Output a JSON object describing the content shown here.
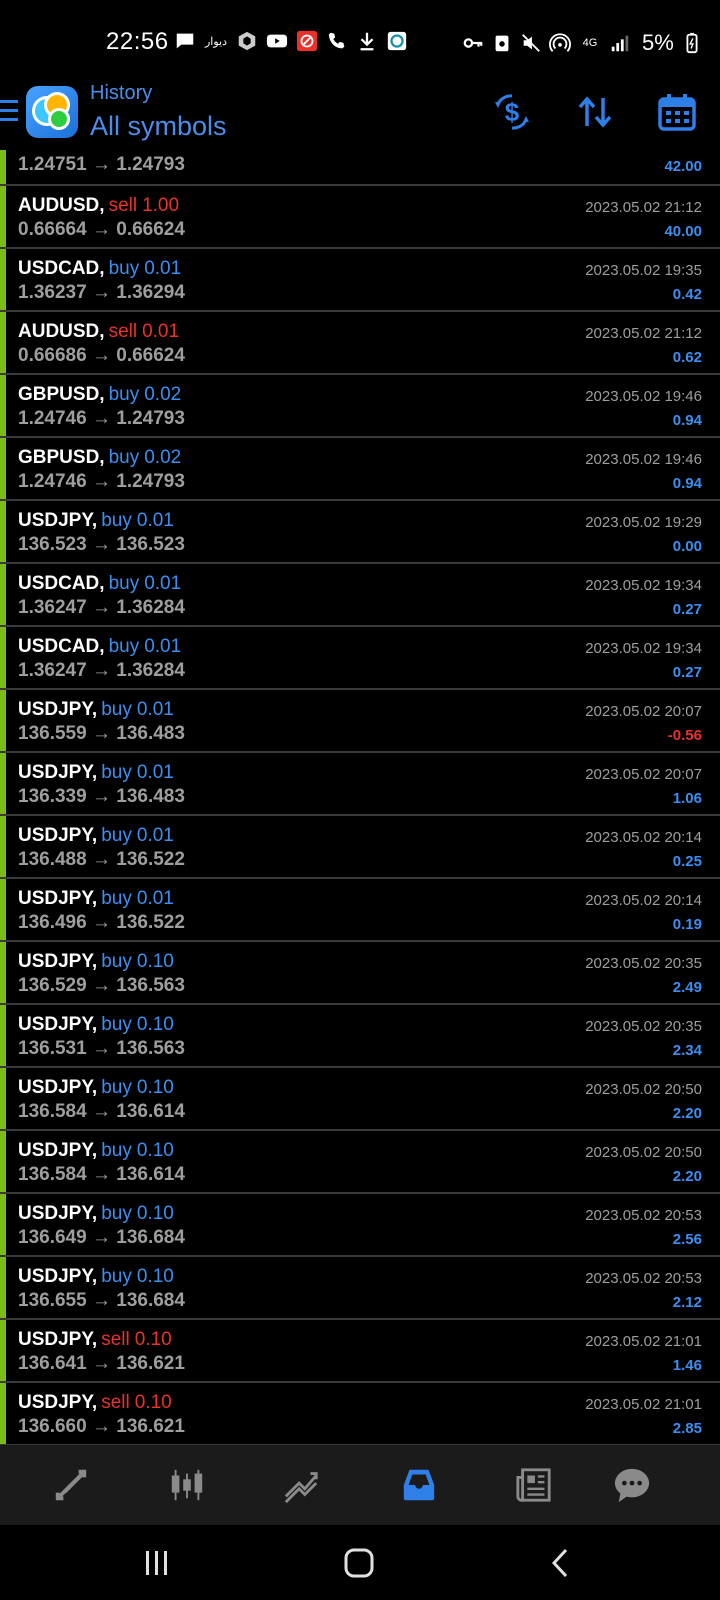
{
  "status_bar": {
    "time": "22:56",
    "left_icons": [
      "message-icon",
      "app-text-icon",
      "hexagon-icon",
      "youtube-icon",
      "no-entry-icon",
      "wifi-call-icon",
      "download-icon",
      "app-icon"
    ],
    "app_text": "دیوار",
    "network": "4G",
    "battery": "5%"
  },
  "header": {
    "title": "History",
    "subtitle": "All symbols",
    "accent": "#2f7fe8"
  },
  "trades": [
    {
      "symbol": "",
      "side": "",
      "volume": "",
      "open": "1.24751",
      "close": "1.24793",
      "time": "",
      "profit": "42.00",
      "negative": false,
      "partial": true
    },
    {
      "symbol": "AUDUSD,",
      "side": "sell",
      "volume": "1.00",
      "open": "0.66664",
      "close": "0.66624",
      "time": "2023.05.02 21:12",
      "profit": "40.00",
      "negative": false
    },
    {
      "symbol": "USDCAD,",
      "side": "buy",
      "volume": "0.01",
      "open": "1.36237",
      "close": "1.36294",
      "time": "2023.05.02 19:35",
      "profit": "0.42",
      "negative": false
    },
    {
      "symbol": "AUDUSD,",
      "side": "sell",
      "volume": "0.01",
      "open": "0.66686",
      "close": "0.66624",
      "time": "2023.05.02 21:12",
      "profit": "0.62",
      "negative": false
    },
    {
      "symbol": "GBPUSD,",
      "side": "buy",
      "volume": "0.02",
      "open": "1.24746",
      "close": "1.24793",
      "time": "2023.05.02 19:46",
      "profit": "0.94",
      "negative": false
    },
    {
      "symbol": "GBPUSD,",
      "side": "buy",
      "volume": "0.02",
      "open": "1.24746",
      "close": "1.24793",
      "time": "2023.05.02 19:46",
      "profit": "0.94",
      "negative": false
    },
    {
      "symbol": "USDJPY,",
      "side": "buy",
      "volume": "0.01",
      "open": "136.523",
      "close": "136.523",
      "time": "2023.05.02 19:29",
      "profit": "0.00",
      "negative": false
    },
    {
      "symbol": "USDCAD,",
      "side": "buy",
      "volume": "0.01",
      "open": "1.36247",
      "close": "1.36284",
      "time": "2023.05.02 19:34",
      "profit": "0.27",
      "negative": false
    },
    {
      "symbol": "USDCAD,",
      "side": "buy",
      "volume": "0.01",
      "open": "1.36247",
      "close": "1.36284",
      "time": "2023.05.02 19:34",
      "profit": "0.27",
      "negative": false
    },
    {
      "symbol": "USDJPY,",
      "side": "buy",
      "volume": "0.01",
      "open": "136.559",
      "close": "136.483",
      "time": "2023.05.02 20:07",
      "profit": "-0.56",
      "negative": true
    },
    {
      "symbol": "USDJPY,",
      "side": "buy",
      "volume": "0.01",
      "open": "136.339",
      "close": "136.483",
      "time": "2023.05.02 20:07",
      "profit": "1.06",
      "negative": false
    },
    {
      "symbol": "USDJPY,",
      "side": "buy",
      "volume": "0.01",
      "open": "136.488",
      "close": "136.522",
      "time": "2023.05.02 20:14",
      "profit": "0.25",
      "negative": false
    },
    {
      "symbol": "USDJPY,",
      "side": "buy",
      "volume": "0.01",
      "open": "136.496",
      "close": "136.522",
      "time": "2023.05.02 20:14",
      "profit": "0.19",
      "negative": false
    },
    {
      "symbol": "USDJPY,",
      "side": "buy",
      "volume": "0.10",
      "open": "136.529",
      "close": "136.563",
      "time": "2023.05.02 20:35",
      "profit": "2.49",
      "negative": false
    },
    {
      "symbol": "USDJPY,",
      "side": "buy",
      "volume": "0.10",
      "open": "136.531",
      "close": "136.563",
      "time": "2023.05.02 20:35",
      "profit": "2.34",
      "negative": false
    },
    {
      "symbol": "USDJPY,",
      "side": "buy",
      "volume": "0.10",
      "open": "136.584",
      "close": "136.614",
      "time": "2023.05.02 20:50",
      "profit": "2.20",
      "negative": false
    },
    {
      "symbol": "USDJPY,",
      "side": "buy",
      "volume": "0.10",
      "open": "136.584",
      "close": "136.614",
      "time": "2023.05.02 20:50",
      "profit": "2.20",
      "negative": false
    },
    {
      "symbol": "USDJPY,",
      "side": "buy",
      "volume": "0.10",
      "open": "136.649",
      "close": "136.684",
      "time": "2023.05.02 20:53",
      "profit": "2.56",
      "negative": false
    },
    {
      "symbol": "USDJPY,",
      "side": "buy",
      "volume": "0.10",
      "open": "136.655",
      "close": "136.684",
      "time": "2023.05.02 20:53",
      "profit": "2.12",
      "negative": false
    },
    {
      "symbol": "USDJPY,",
      "side": "sell",
      "volume": "0.10",
      "open": "136.641",
      "close": "136.621",
      "time": "2023.05.02 21:01",
      "profit": "1.46",
      "negative": false
    },
    {
      "symbol": "USDJPY,",
      "side": "sell",
      "volume": "0.10",
      "open": "136.660",
      "close": "136.621",
      "time": "2023.05.02 21:01",
      "profit": "2.85",
      "negative": false
    }
  ],
  "colors": {
    "buy": "#3c8ef0",
    "sell": "#e8322b",
    "positive_profit": "#3c8ef0",
    "negative_profit": "#e8322b",
    "row_marker": "#7cbc1a"
  },
  "tabs": [
    {
      "name": "quotes",
      "icon": "quotes-arrows-icon",
      "active": false
    },
    {
      "name": "chart",
      "icon": "candlestick-icon",
      "active": false
    },
    {
      "name": "trade",
      "icon": "trend-lines-icon",
      "active": false
    },
    {
      "name": "history",
      "icon": "inbox-icon",
      "active": true
    },
    {
      "name": "news",
      "icon": "newspaper-icon",
      "active": false
    },
    {
      "name": "messages",
      "icon": "chat-bubble-icon",
      "active": false
    }
  ],
  "nav": [
    "recents-icon",
    "home-icon",
    "back-icon"
  ]
}
